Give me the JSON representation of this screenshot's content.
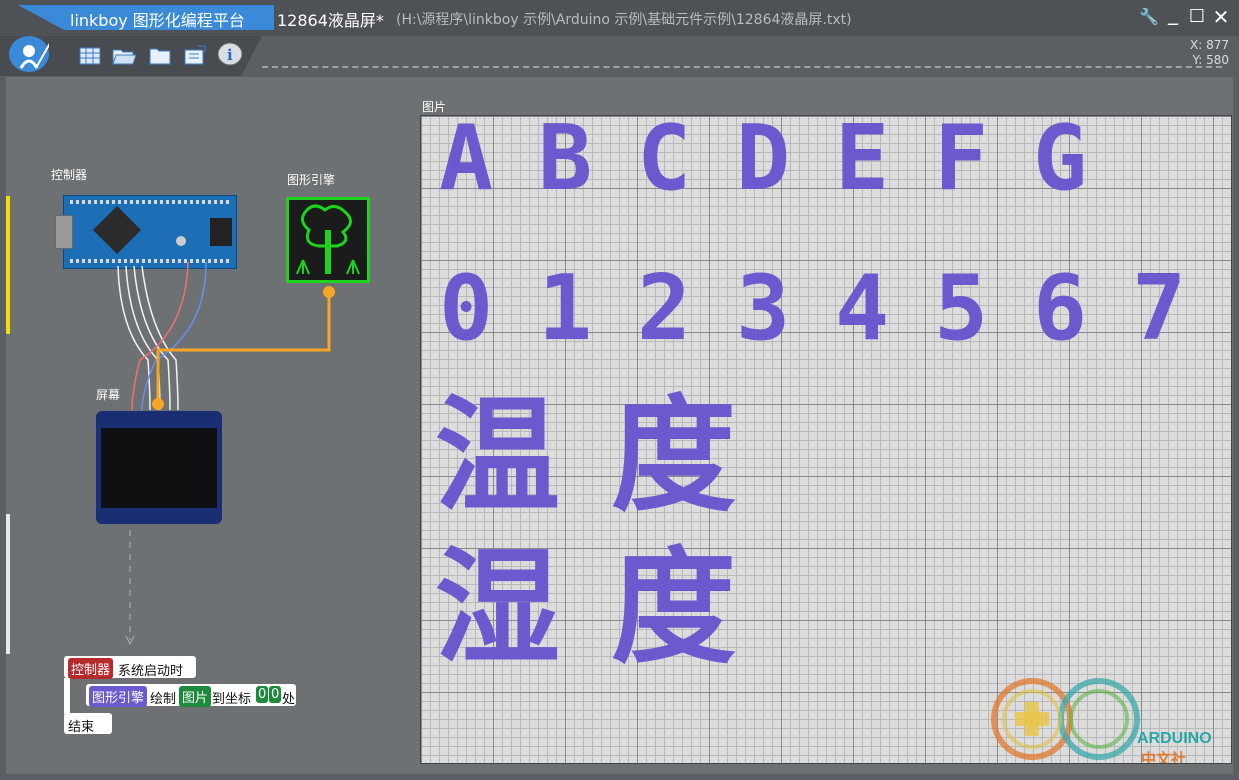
{
  "titlebar": {
    "app_title": "linkboy 图形化编程平台",
    "doc_title": "12864液晶屏*",
    "doc_path": "(H:\\源程序\\linkboy 示例\\Arduino 示例\\基础元件示例\\12864液晶屏.txt)",
    "settings_glyph": "🔧",
    "minimize_glyph": "_",
    "maximize_glyph": "☐",
    "close_glyph": "✕"
  },
  "coords": {
    "x": "X: 877",
    "y": "Y: 580"
  },
  "modules": {
    "controller_label": "控制器",
    "engine_label": "图形引擎",
    "screen_label": "屏幕"
  },
  "code": {
    "event_tag": "控制器",
    "event_text": "系统启动时",
    "engine_tag": "图形引擎",
    "draw_text": "绘制",
    "image_tag": "图片",
    "to_coord_text": "到坐标",
    "x_val": "0",
    "y_val": "0",
    "place_text": "处",
    "end_text": "结束"
  },
  "canvas": {
    "label": "图片",
    "letters": [
      "A",
      "B",
      "C",
      "D",
      "E",
      "F",
      "G"
    ],
    "digits": [
      "0",
      "1",
      "2",
      "3",
      "4",
      "5",
      "6",
      "7"
    ],
    "cn_row1": [
      "温",
      "度"
    ],
    "cn_row2": [
      "湿",
      "度"
    ]
  },
  "watermark": {
    "line1": "ARDUINO",
    "line2": "中文社区"
  },
  "colors": {
    "accent": "#3b8ad8",
    "glyph": "#6a5acd",
    "engine_green": "#1dd31d",
    "wire_orange": "#f5a623"
  }
}
